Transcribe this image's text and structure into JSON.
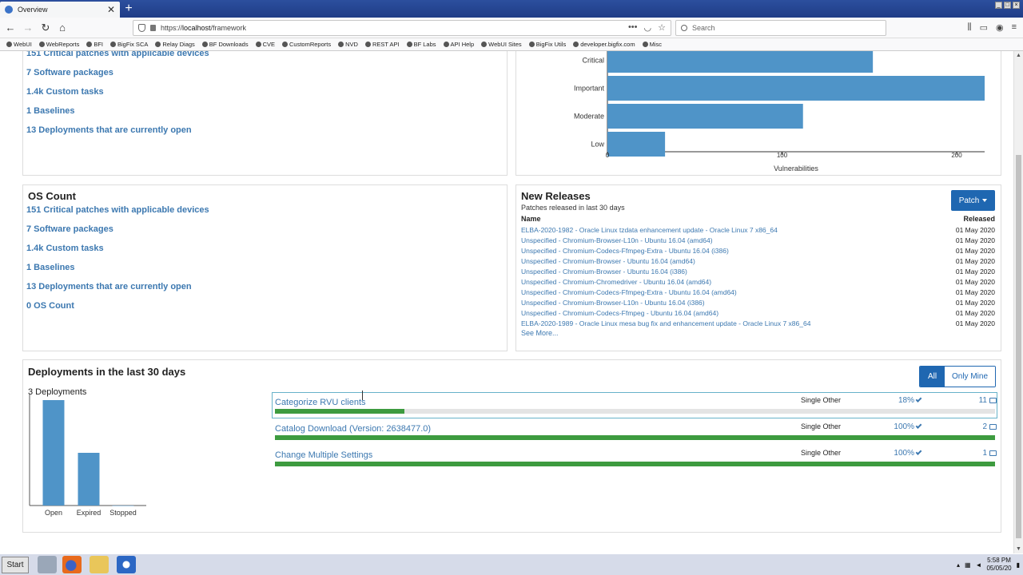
{
  "browser": {
    "tab_title": "Overview",
    "tab_close": "✕",
    "new_tab": "+",
    "url_prefix": "https://",
    "url_host": "localhost",
    "url_path": "/framework",
    "search_placeholder": "Search",
    "bookmarks": [
      "WebUI",
      "WebReports",
      "BFI",
      "BigFix SCA",
      "Relay Diags",
      "BF Downloads",
      "CVE",
      "CustomReports",
      "NVD",
      "REST API",
      "BF Labs",
      "API Help",
      "WebUI Sites",
      "BigFix Utils",
      "developer.bigfix.com",
      "Misc"
    ]
  },
  "top_panel": {
    "links": [
      "151 Critical patches with applicable devices",
      "7 Software packages",
      "1.4k Custom tasks",
      "1 Baselines",
      "13 Deployments that are currently open"
    ]
  },
  "chart_data": [
    {
      "type": "bar",
      "orientation": "horizontal",
      "categories": [
        "Critical",
        "Important",
        "Moderate",
        "Low"
      ],
      "values": [
        152,
        216,
        112,
        33
      ],
      "xlabel": "Vulnerabilities",
      "xticks": [
        0,
        100,
        200
      ],
      "xlim": [
        0,
        216
      ],
      "color": "#4f94c8"
    },
    {
      "type": "bar",
      "categories": [
        "Open",
        "Expired",
        "Stopped"
      ],
      "values": [
        2,
        1,
        0
      ],
      "ylim": [
        0,
        2
      ],
      "color": "#4f94c8"
    }
  ],
  "os_panel": {
    "title": "OS Count",
    "links": [
      "151 Critical patches with applicable devices",
      "7 Software packages",
      "1.4k Custom tasks",
      "1 Baselines",
      "13 Deployments that are currently open",
      "0 OS Count"
    ]
  },
  "new_releases": {
    "title": "New Releases",
    "subtitle": "Patches released in last 30 days",
    "col_name": "Name",
    "col_released": "Released",
    "button": "Patch",
    "see_more": "See More...",
    "rows": [
      {
        "name": "ELBA-2020-1982 - Oracle Linux tzdata enhancement update - Oracle Linux 7 x86_64",
        "date": "01 May 2020"
      },
      {
        "name": "Unspecified - Chromium-Browser-L10n - Ubuntu 16.04 (amd64)",
        "date": "01 May 2020"
      },
      {
        "name": "Unspecified - Chromium-Codecs-Ffmpeg-Extra - Ubuntu 16.04 (i386)",
        "date": "01 May 2020"
      },
      {
        "name": "Unspecified - Chromium-Browser - Ubuntu 16.04 (amd64)",
        "date": "01 May 2020"
      },
      {
        "name": "Unspecified - Chromium-Browser - Ubuntu 16.04 (i386)",
        "date": "01 May 2020"
      },
      {
        "name": "Unspecified - Chromium-Chromedriver - Ubuntu 16.04 (amd64)",
        "date": "01 May 2020"
      },
      {
        "name": "Unspecified - Chromium-Codecs-Ffmpeg-Extra - Ubuntu 16.04 (amd64)",
        "date": "01 May 2020"
      },
      {
        "name": "Unspecified - Chromium-Browser-L10n - Ubuntu 16.04 (i386)",
        "date": "01 May 2020"
      },
      {
        "name": "Unspecified - Chromium-Codecs-Ffmpeg - Ubuntu 16.04 (amd64)",
        "date": "01 May 2020"
      },
      {
        "name": "ELBA-2020-1989 - Oracle Linux mesa bug fix and enhancement update - Oracle Linux 7 x86_64",
        "date": "01 May 2020"
      }
    ]
  },
  "deployments": {
    "title": "Deployments in the last 30 days",
    "count_number": "3",
    "count_label": " Deployments",
    "filter_all": "All",
    "filter_mine": "Only Mine",
    "rows": [
      {
        "name": "Categorize RVU clients",
        "type": "Single Other",
        "percent": "18%",
        "progress": 0.18,
        "devices": "11"
      },
      {
        "name": "Catalog Download (Version: 2638477.0)",
        "type": "Single Other",
        "percent": "100%",
        "progress": 1.0,
        "devices": "2"
      },
      {
        "name": "Change Multiple Settings",
        "type": "Single Other",
        "percent": "100%",
        "progress": 1.0,
        "devices": "1"
      }
    ]
  },
  "taskbar": {
    "start": "Start",
    "time": "5:58 PM",
    "date": "05/05/20"
  }
}
